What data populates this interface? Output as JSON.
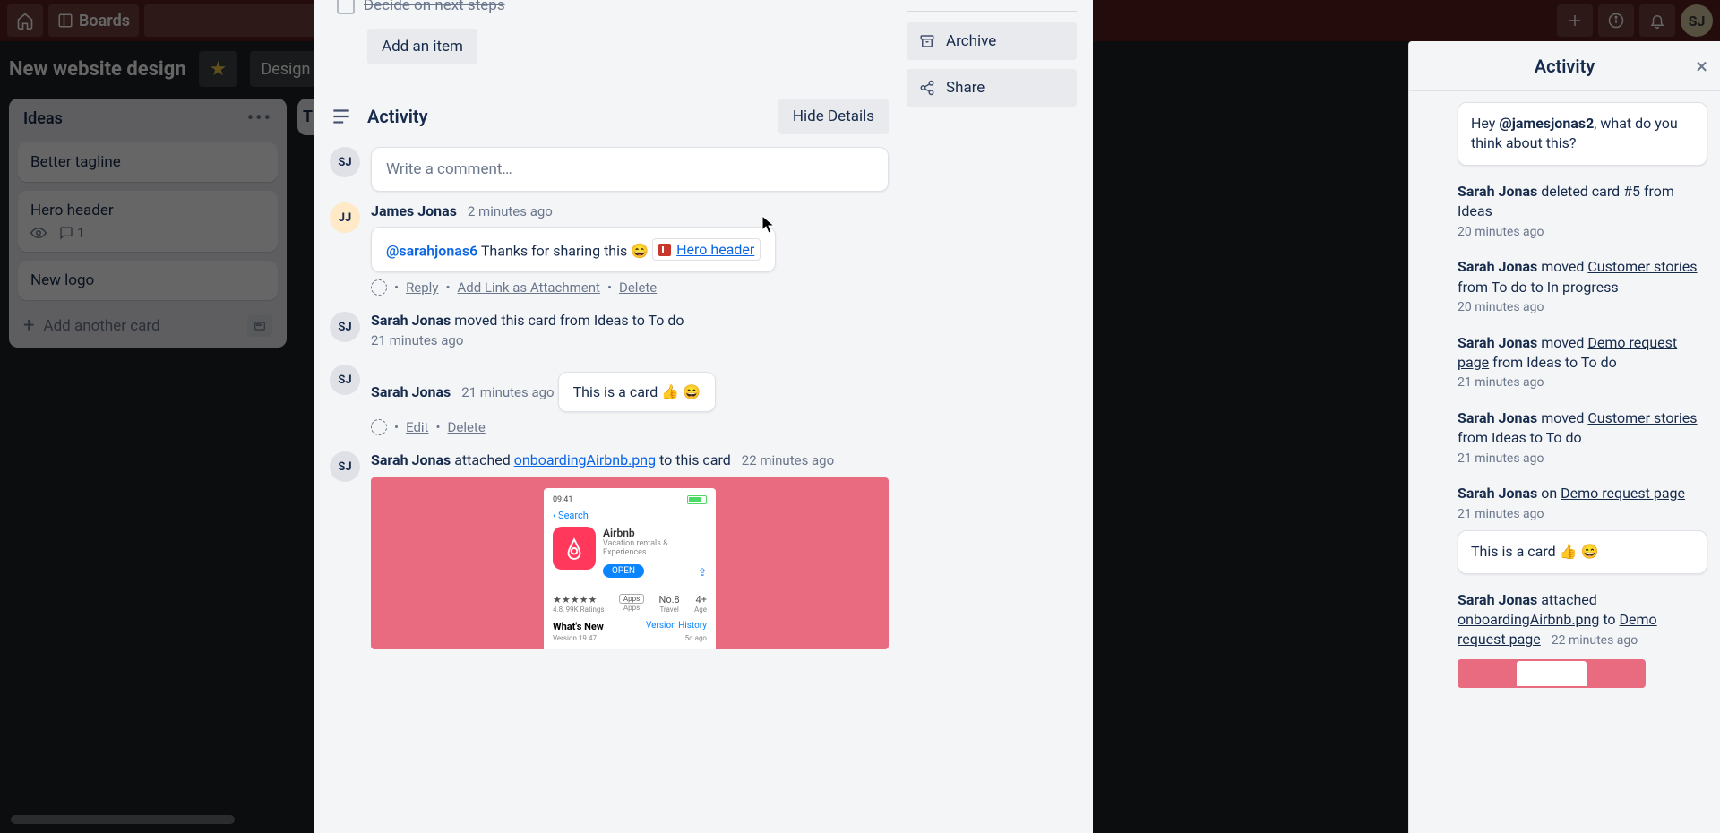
{
  "nav": {
    "boards": "Boards",
    "avatar_initials": "SJ"
  },
  "board": {
    "title": "New website design",
    "btn_design": "Design"
  },
  "lists": {
    "ideas": {
      "title": "Ideas",
      "cards": {
        "tagline": "Better tagline",
        "hero": "Hero header",
        "hero_comments": "1",
        "logo": "New logo"
      },
      "add": "Add another card"
    },
    "list2_first_letter": "T"
  },
  "modal": {
    "checklist_item": "Decide on next steps",
    "add_item": "Add an item",
    "side": {
      "archive": "Archive",
      "share": "Share"
    },
    "activity": {
      "title": "Activity",
      "hide": "Hide Details",
      "comment_placeholder": "Write a comment…",
      "avatar_sj": "SJ",
      "avatar_jj": "JJ",
      "items": {
        "james_name": "James Jonas",
        "james_time": "2 minutes ago",
        "james_mention": "@sarahjonas6",
        "james_text": " Thanks for sharing this 😄 ",
        "james_link": "Hero header",
        "james_actions": {
          "reply": "Reply",
          "addlink": "Add Link as Attachment",
          "delete": "Delete"
        },
        "move_name": "Sarah Jonas",
        "move_text": " moved this card from Ideas to To do",
        "move_time": "21 minutes ago",
        "sc_name": "Sarah Jonas",
        "sc_time": "21 minutes ago",
        "sc_body": "This is a card 👍 😄",
        "sc_actions": {
          "edit": "Edit",
          "delete": "Delete"
        },
        "att_name": "Sarah Jonas",
        "att_verb": " attached ",
        "att_file": "onboardingAirbnb.png",
        "att_suffix": " to this card",
        "att_time": "22 minutes ago"
      }
    }
  },
  "phone": {
    "time": "09:41",
    "back": "Search",
    "app_name": "Airbnb",
    "app_sub": "Vacation rentals & Experiences",
    "open": "OPEN",
    "stars": "★★★★★",
    "rating_sub": "4.8, 99K Ratings",
    "pill": "Apps",
    "rank": "No.8",
    "rank_sub": "Travel",
    "age": "4+",
    "age_sub": "Age",
    "whatsnew": "What's New",
    "version_history": "Version History",
    "version_line": "Version 19.47",
    "version_time": "5d ago"
  },
  "drawer": {
    "title": "Activity",
    "items": {
      "hey_prefix": "Hey ",
      "hey_mention": "@jamesjonas2",
      "hey_suffix": ", what do you think about this?",
      "del_name": "Sarah Jonas",
      "del_text": " deleted card #5 from Ideas",
      "del_ts": "20 minutes ago",
      "mv1_name": "Sarah Jonas",
      "mv1_verb": " moved ",
      "mv1_link": "Customer stories",
      "mv1_suffix": " from To do to In progress",
      "mv1_ts": "20 minutes ago",
      "mv2_name": "Sarah Jonas",
      "mv2_verb": " moved ",
      "mv2_link": "Demo request page",
      "mv2_suffix": " from Ideas to To do",
      "mv2_ts": "21 minutes ago",
      "mv3_name": "Sarah Jonas",
      "mv3_verb": " moved ",
      "mv3_link": "Customer stories",
      "mv3_suffix": " from Ideas to To do",
      "mv3_ts": "21 minutes ago",
      "on_name": "Sarah Jonas",
      "on_verb": " on ",
      "on_link": "Demo request page",
      "on_ts": "21 minutes ago",
      "on_quote": "This is a card 👍 😄",
      "att_name": "Sarah Jonas",
      "att_verb": " attached ",
      "att_file": "onboardingAirbnb.png",
      "att_to": " to ",
      "att_link": "Demo request page",
      "att_ts": "22 minutes ago"
    }
  }
}
